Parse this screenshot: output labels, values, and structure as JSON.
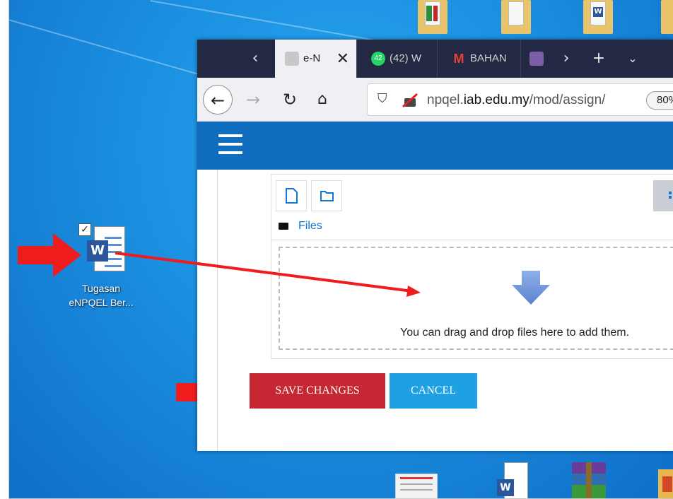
{
  "desktop": {
    "word_file": {
      "label_line1": "Tugasan",
      "label_line2": "eNPQEL Ber...",
      "badge": "W"
    }
  },
  "browser": {
    "tabs": [
      {
        "label": "e-N",
        "icon": "moodle-icon",
        "active": true
      },
      {
        "label": "(42) W",
        "badge": "42",
        "icon": "whatsapp-icon"
      },
      {
        "label": "BAHAN",
        "icon": "gmail-icon"
      },
      {
        "label": "",
        "icon": "app-icon"
      }
    ],
    "url_prefix": "npqel.",
    "url_host": "iab.edu.my",
    "url_path": "/mod/assign/",
    "zoom": "80%"
  },
  "filepicker": {
    "path_label": "Files",
    "drop_text": "You can drag and drop files here to add them."
  },
  "buttons": {
    "save": "SAVE CHANGES",
    "cancel": "CANCEL"
  },
  "colors": {
    "header": "#0f6cbf",
    "save": "#c62833",
    "cancel": "#1fa0e4",
    "tabbar": "#232942",
    "arrow": "#ee1c1c"
  }
}
